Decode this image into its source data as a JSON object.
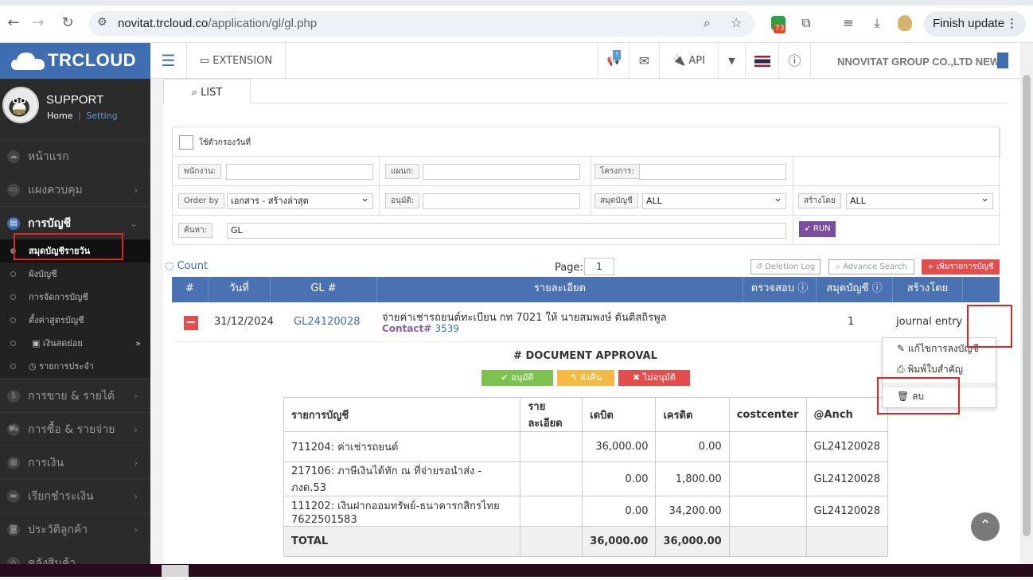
{
  "browser": {
    "url_host": "novitat.trcloud.co",
    "url_path": "/application/gl/gl.php",
    "ext_badge": "73",
    "finish_update": "Finish update"
  },
  "sidebar": {
    "logo": "TRCLOUD",
    "profile_name": "SUPPORT",
    "link_home": "Home",
    "link_sep": "|",
    "link_setting": "Setting",
    "menu": [
      {
        "label": "หน้าแรก"
      },
      {
        "label": "แผงควบคุม"
      },
      {
        "label": "การบัญชี"
      },
      {
        "label": "การขาย & รายได้"
      },
      {
        "label": "การซื้อ & รายจ่าย"
      },
      {
        "label": "การเงิน"
      },
      {
        "label": "เรียกชำระเงิน"
      },
      {
        "label": "ประวัติลูกค้า"
      },
      {
        "label": "คลังสินค้า"
      }
    ],
    "submenu": [
      {
        "label": "สมุดบัญชีรายวัน"
      },
      {
        "label": "ผังบัญชี"
      },
      {
        "label": "การจัดการบัญชี"
      },
      {
        "label": "ตั้งค่าสูตรบัญชี"
      },
      {
        "label": "เงินสดย่อย"
      },
      {
        "label": "รายการประจำ"
      }
    ]
  },
  "topbar": {
    "extension": "EXTENSION",
    "api": "API",
    "notify_badge": "!",
    "company": "NNOVITAT GROUP CO.,LTD NEW"
  },
  "tab": {
    "list": "LIST"
  },
  "filter": {
    "date_filter": "ใช้ตัวกรองวันที่",
    "employee_label": "พนักงาน:",
    "department_label": "แผนก:",
    "project_label": "โครงการ:",
    "orderby_label": "Order by",
    "orderby_value": "เอกสาร - สร้างล่าสุด",
    "approve_label": "อนุมัติ:",
    "journal_label": "สมุดบัญชี",
    "journal_value": "ALL",
    "createdby_label": "สร้างโดย",
    "createdby_value": "ALL",
    "search_label": "ค้นหา:",
    "search_value": "GL",
    "run": "RUN"
  },
  "list": {
    "count": "Count",
    "page_label": "Page:",
    "page_value": "1",
    "deletion_log": "Deletion Log",
    "advance_search": "Advance Search",
    "add": "+ เพิ่มรายการบัญชี",
    "headers": [
      "#",
      "วันที่",
      "GL #",
      "รายละเอียด",
      "ตรวจสอบ",
      "สมุดบัญชี",
      "สร้างโดย"
    ],
    "row": {
      "date": "31/12/2024",
      "gl": "GL24120028",
      "detail": "จ่ายค่าเช่ารถยนต์ทะเบียน กท 7021 ให้ นายสมพงษ์ ตันติสถิรพูล",
      "contact_label": "Contact#",
      "contact_value": "3539",
      "journal": "1",
      "created_by": "journal entry"
    }
  },
  "approval": {
    "title": "# DOCUMENT APPROVAL",
    "approve": "อนุมัติ",
    "return": "ส่งคืน",
    "reject": "ไม่อนุมัติ"
  },
  "journal_table": {
    "headers": [
      "รายการบัญชี",
      "รายละเอียด",
      "เดบิต",
      "เครดิต",
      "costcenter",
      "@Anch"
    ],
    "rows": [
      [
        "711204: ค่าเช่ารถยนต์",
        "",
        "36,000.00",
        "0.00",
        "",
        "GL24120028"
      ],
      [
        "217106: ภาษีเงินได้หัก ณ ที่จ่ายรอนำส่ง - ภงด.53",
        "",
        "0.00",
        "1,800.00",
        "",
        "GL24120028"
      ],
      [
        "111202: เงินฝากออมทรัพย์-ธนาคารกสิกรไทย 7622501583",
        "",
        "0.00",
        "34,200.00",
        "",
        "GL24120028"
      ]
    ],
    "total": [
      "TOTAL",
      "",
      "36,000.00",
      "36,000.00",
      "",
      ""
    ]
  },
  "dropdown": {
    "edit": "แก้ไขการลงบัญชี",
    "print": "พิมพ์ใบสำคัญ",
    "delete": "ลบ"
  },
  "colors": {
    "brand": "#3e6db0",
    "header": "#4a71b1",
    "danger": "#e74c4c",
    "success": "#7cc24e",
    "warning": "#f5b942",
    "highlight": "#e02424"
  }
}
